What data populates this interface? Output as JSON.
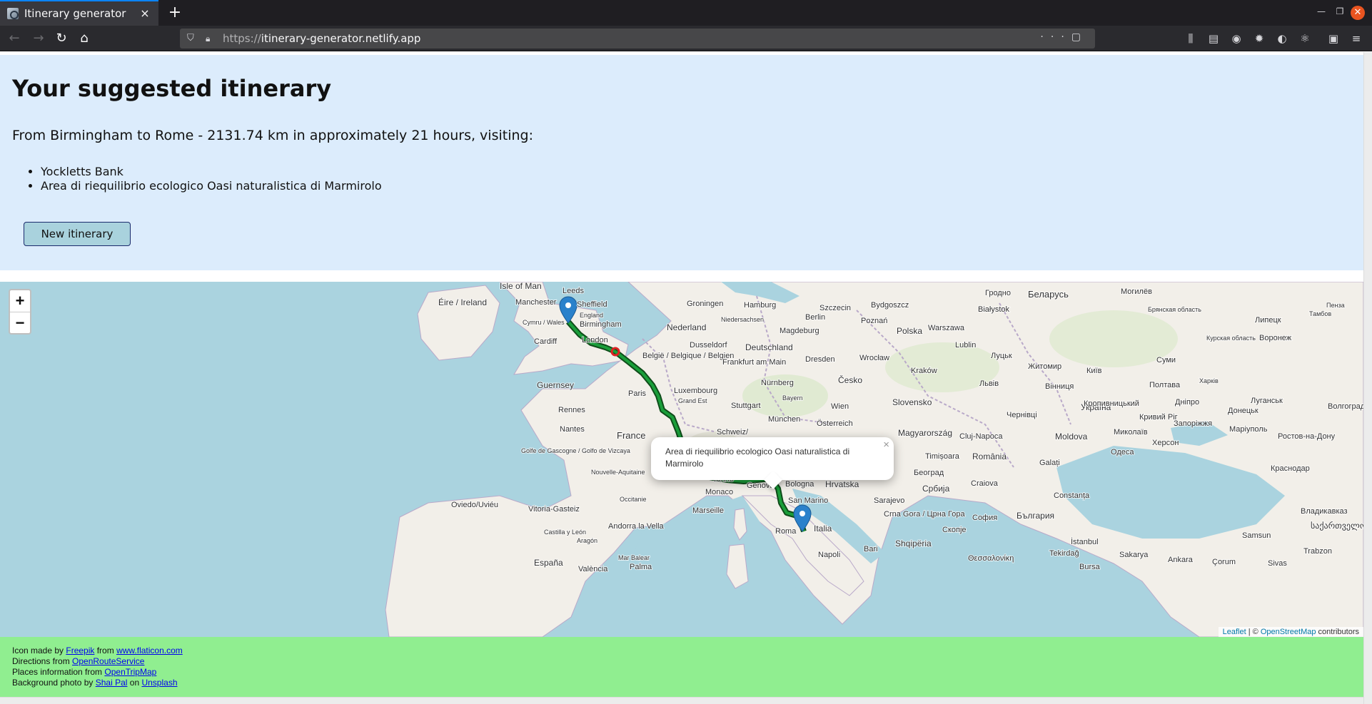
{
  "browser": {
    "tab_title": "Itinerary generator",
    "url_protocol": "https://",
    "url_host": "itinerary-generator.netlify.app",
    "tab_close_glyph": "×",
    "new_tab_glyph": "+"
  },
  "itinerary": {
    "heading": "Your suggested itinerary",
    "summary": "From Birmingham to Rome - 2131.74 km in approximately 21 hours, visiting:",
    "stops": [
      "Yockletts Bank",
      "Area di riequilibrio ecologico Oasi naturalistica di Marmirolo"
    ],
    "new_button_label": "New itinerary"
  },
  "map": {
    "zoom_in": "+",
    "zoom_out": "−",
    "popup_text": "Area di riequilibrio ecologico Oasi naturalistica di Marmirolo",
    "popup_close": "×",
    "attribution_leaflet": "Leaflet",
    "attribution_sep": " | © ",
    "attribution_osm": "OpenStreetMap",
    "attribution_tail": " contributors",
    "labels": [
      {
        "text": "Isle of Man",
        "name": "label-isle-of-man"
      },
      {
        "text": "Leeds",
        "name": "label-leeds"
      },
      {
        "text": "Éire / Ireland",
        "name": "label-ireland"
      },
      {
        "text": "Manchester",
        "name": "label-manchester"
      },
      {
        "text": "Sheffield",
        "name": "label-sheffield"
      },
      {
        "text": "England",
        "name": "label-england"
      },
      {
        "text": "Cymru / Wales",
        "name": "label-wales"
      },
      {
        "text": "Birmingham",
        "name": "label-birmingham"
      },
      {
        "text": "Cardiff",
        "name": "label-cardiff"
      },
      {
        "text": "London",
        "name": "label-london"
      },
      {
        "text": "Guernsey",
        "name": "label-guernsey"
      },
      {
        "text": "Rennes",
        "name": "label-rennes"
      },
      {
        "text": "Nantes",
        "name": "label-nantes"
      },
      {
        "text": "Paris",
        "name": "label-paris"
      },
      {
        "text": "France",
        "name": "label-france"
      },
      {
        "text": "Golfe de Gascogne / Golfo de Vizcaya",
        "name": "label-golfe"
      },
      {
        "text": "Nouvelle-Aquitaine",
        "name": "label-nouvelle-aquitaine"
      },
      {
        "text": "Occitanie",
        "name": "label-occitanie"
      },
      {
        "text": "Oviedo/Uviéu",
        "name": "label-oviedo"
      },
      {
        "text": "Vitoria-Gasteiz",
        "name": "label-vitoria"
      },
      {
        "text": "Castilla y León",
        "name": "label-castilla"
      },
      {
        "text": "Andorra la Vella",
        "name": "label-andorra"
      },
      {
        "text": "Aragón",
        "name": "label-aragon"
      },
      {
        "text": "España",
        "name": "label-espana"
      },
      {
        "text": "València",
        "name": "label-valencia"
      },
      {
        "text": "Palma",
        "name": "label-palma"
      },
      {
        "text": "Mar Balear",
        "name": "label-mar-balear"
      },
      {
        "text": "Marseille",
        "name": "label-marseille"
      },
      {
        "text": "Monaco",
        "name": "label-monaco"
      },
      {
        "text": "Torino",
        "name": "label-torino"
      },
      {
        "text": "Genova",
        "name": "label-genova"
      },
      {
        "text": "Bologna",
        "name": "label-bologna"
      },
      {
        "text": "San Marino",
        "name": "label-san-marino"
      },
      {
        "text": "Italia",
        "name": "label-italia"
      },
      {
        "text": "Roma",
        "name": "label-roma"
      },
      {
        "text": "Napoli",
        "name": "label-napoli"
      },
      {
        "text": "Bari",
        "name": "label-bari"
      },
      {
        "text": "Schweiz/",
        "name": "label-schweiz"
      },
      {
        "text": "Nederland",
        "name": "label-nederland"
      },
      {
        "text": "België / Belgique / Belgien",
        "name": "label-belgie"
      },
      {
        "text": "Luxembourg",
        "name": "label-luxembourg"
      },
      {
        "text": "Grand Est",
        "name": "label-grand-est"
      },
      {
        "text": "Dusseldorf",
        "name": "label-dusseldorf"
      },
      {
        "text": "Frankfurt am Main",
        "name": "label-frankfurt"
      },
      {
        "text": "Nürnberg",
        "name": "label-nurnberg"
      },
      {
        "text": "Stuttgart",
        "name": "label-stuttgart"
      },
      {
        "text": "München",
        "name": "label-munchen"
      },
      {
        "text": "Bayern",
        "name": "label-bayern"
      },
      {
        "text": "Deutschland",
        "name": "label-deutschland"
      },
      {
        "text": "Groningen",
        "name": "label-groningen"
      },
      {
        "text": "Hamburg",
        "name": "label-hamburg"
      },
      {
        "text": "Niedersachsen",
        "name": "label-niedersachsen"
      },
      {
        "text": "Magdeburg",
        "name": "label-magdeburg"
      },
      {
        "text": "Berlin",
        "name": "label-berlin"
      },
      {
        "text": "Dresden",
        "name": "label-dresden"
      },
      {
        "text": "Szczecin",
        "name": "label-szczecin"
      },
      {
        "text": "Bydgoszcz",
        "name": "label-bydgoszcz"
      },
      {
        "text": "Poznań",
        "name": "label-poznan"
      },
      {
        "text": "Polska",
        "name": "label-polska"
      },
      {
        "text": "Warszawa",
        "name": "label-warszawa"
      },
      {
        "text": "Wrocław",
        "name": "label-wroclaw"
      },
      {
        "text": "Kraków",
        "name": "label-krakow"
      },
      {
        "text": "Lublin",
        "name": "label-lublin"
      },
      {
        "text": "Česko",
        "name": "label-cesko"
      },
      {
        "text": "Wien",
        "name": "label-wien"
      },
      {
        "text": "Österreich",
        "name": "label-osterreich"
      },
      {
        "text": "Slovensko",
        "name": "label-slovensko"
      },
      {
        "text": "Magyarország",
        "name": "label-magyarorszag"
      },
      {
        "text": "Hrvatska",
        "name": "label-hrvatska"
      },
      {
        "text": "Србија",
        "name": "label-srbija"
      },
      {
        "text": "Sarajevo",
        "name": "label-sarajevo"
      },
      {
        "text": "Crna Gora / Црна Гора",
        "name": "label-crna-gora"
      },
      {
        "text": "Shqipëria",
        "name": "label-shqiperia"
      },
      {
        "text": "Београд",
        "name": "label-beograd"
      },
      {
        "text": "Timișoara",
        "name": "label-timisoara"
      },
      {
        "text": "Cluj-Napoca",
        "name": "label-cluj"
      },
      {
        "text": "România",
        "name": "label-romania"
      },
      {
        "text": "Craiova",
        "name": "label-craiova"
      },
      {
        "text": "Galați",
        "name": "label-galati"
      },
      {
        "text": "Constanța",
        "name": "label-constanta"
      },
      {
        "text": "Moldova",
        "name": "label-moldova"
      },
      {
        "text": "Одеса",
        "name": "label-odesa"
      },
      {
        "text": "България",
        "name": "label-bulgaria"
      },
      {
        "text": "София",
        "name": "label-sofia"
      },
      {
        "text": "Скопје",
        "name": "label-skopje"
      },
      {
        "text": "Θεσσαλονίκη",
        "name": "label-thessaloniki"
      },
      {
        "text": "İstanbul",
        "name": "label-istanbul"
      },
      {
        "text": "Bursa",
        "name": "label-bursa"
      },
      {
        "text": "Sakarya",
        "name": "label-sakarya"
      },
      {
        "text": "Ankara",
        "name": "label-ankara"
      },
      {
        "text": "Tekirdağ",
        "name": "label-tekirdag"
      },
      {
        "text": "Samsun",
        "name": "label-samsun"
      },
      {
        "text": "Trabzon",
        "name": "label-trabzon"
      },
      {
        "text": "Çorum",
        "name": "label-corum"
      },
      {
        "text": "Sivas",
        "name": "label-sivas"
      },
      {
        "text": "საქართველო",
        "name": "label-georgia"
      },
      {
        "text": "Владикавказ",
        "name": "label-vladikavkaz"
      },
      {
        "text": "Україна",
        "name": "label-ukraina"
      },
      {
        "text": "Київ",
        "name": "label-kyiv"
      },
      {
        "text": "Житомир",
        "name": "label-zhytomyr"
      },
      {
        "text": "Львів",
        "name": "label-lviv"
      },
      {
        "text": "Луцьк",
        "name": "label-lutsk"
      },
      {
        "text": "Вінниця",
        "name": "label-vinnytsia"
      },
      {
        "text": "Чернівці",
        "name": "label-chernivtsi"
      },
      {
        "text": "Кропивницький",
        "name": "label-kropyvnytskyi"
      },
      {
        "text": "Полтава",
        "name": "label-poltava"
      },
      {
        "text": "Харків",
        "name": "label-kharkiv"
      },
      {
        "text": "Дніпро",
        "name": "label-dnipro"
      },
      {
        "text": "Кривий Ріг",
        "name": "label-kryvyi-rih"
      },
      {
        "text": "Запоріжжя",
        "name": "label-zaporizhzhia"
      },
      {
        "text": "Миколаїв",
        "name": "label-mykolaiv"
      },
      {
        "text": "Херсон",
        "name": "label-kherson"
      },
      {
        "text": "Донецьк",
        "name": "label-donetsk"
      },
      {
        "text": "Луганськ",
        "name": "label-luhansk"
      },
      {
        "text": "Маріуполь",
        "name": "label-mariupol"
      },
      {
        "text": "Ростов-на-Дону",
        "name": "label-rostov"
      },
      {
        "text": "Краснодар",
        "name": "label-krasnodar"
      },
      {
        "text": "Волгоград",
        "name": "label-volgograd"
      },
      {
        "text": "Воронеж",
        "name": "label-voronezh"
      },
      {
        "text": "Липецк",
        "name": "label-lipetsk"
      },
      {
        "text": "Суми",
        "name": "label-sumy"
      },
      {
        "text": "Беларусь",
        "name": "label-belarus"
      },
      {
        "text": "Гродно",
        "name": "label-grodno"
      },
      {
        "text": "Białystok",
        "name": "label-bialystok"
      },
      {
        "text": "Могилёв",
        "name": "label-mogilev"
      },
      {
        "text": "Пенза",
        "name": "label-penza"
      },
      {
        "text": "Тамбов",
        "name": "label-tambov"
      },
      {
        "text": "Брянская область",
        "name": "label-bryansk"
      },
      {
        "text": "Курская область",
        "name": "label-kursk"
      }
    ]
  },
  "footer": {
    "line1_prefix": "Icon made by ",
    "line1_link1": "Freepik",
    "line1_mid": " from ",
    "line1_link2": "www.flaticon.com",
    "line2_prefix": "Directions from ",
    "line2_link": "OpenRouteService",
    "line3_prefix": "Places information from ",
    "line3_link": "OpenTripMap",
    "line4_prefix": "Background photo by ",
    "line4_link1": "Shai Pal",
    "line4_mid": " on ",
    "line4_link2": "Unsplash"
  },
  "colors": {
    "route": "#1a7d2e",
    "route_outline": "#0f4d1a",
    "marker": "#2a81cb",
    "water": "#aad3df",
    "land": "#f2efe9",
    "footer_bg": "#90ee90",
    "header_bg": "#dcecfc"
  }
}
